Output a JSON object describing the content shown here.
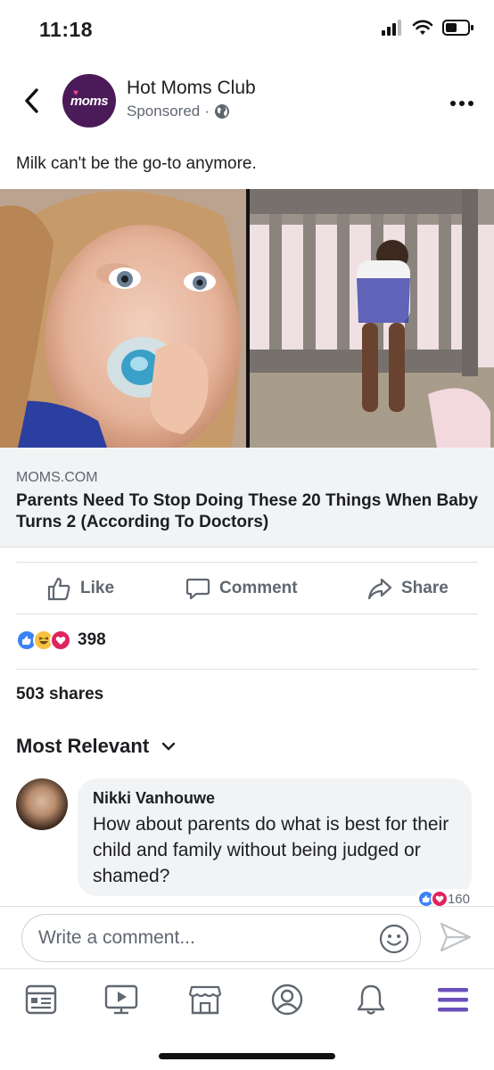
{
  "status_bar": {
    "time": "11:18"
  },
  "post": {
    "page_name": "Hot Moms Club",
    "avatar_text": "moms",
    "sponsored_label": "Sponsored",
    "sponsored_separator": "·",
    "caption": "Milk can't be the go-to anymore.",
    "link": {
      "domain": "MOMS.COM",
      "title": "Parents Need To Stop Doing These 20 Things When Baby Turns 2 (According To Doctors)"
    }
  },
  "actions": {
    "like": "Like",
    "comment": "Comment",
    "share": "Share"
  },
  "stats": {
    "reaction_count": "398",
    "shares": "503 shares"
  },
  "comments": {
    "sort_label": "Most Relevant",
    "items": [
      {
        "author": "Nikki Vanhouwe",
        "text": "How about parents do what is best for their child and family without being judged or shamed?",
        "reaction_count": "160"
      }
    ]
  },
  "composer": {
    "placeholder": "Write a comment..."
  },
  "colors": {
    "accent_blue": "#1877f2",
    "like_blue": "#3b82f6",
    "love_red": "#e0245e",
    "haha_yellow": "#f7c244",
    "tab_active_purple": "#6b4fbb",
    "avatar_purple": "#4b1a58"
  },
  "icons": {
    "tabs": [
      "news-feed-icon",
      "watch-icon",
      "marketplace-icon",
      "profile-icon",
      "notifications-icon",
      "menu-icon"
    ]
  }
}
